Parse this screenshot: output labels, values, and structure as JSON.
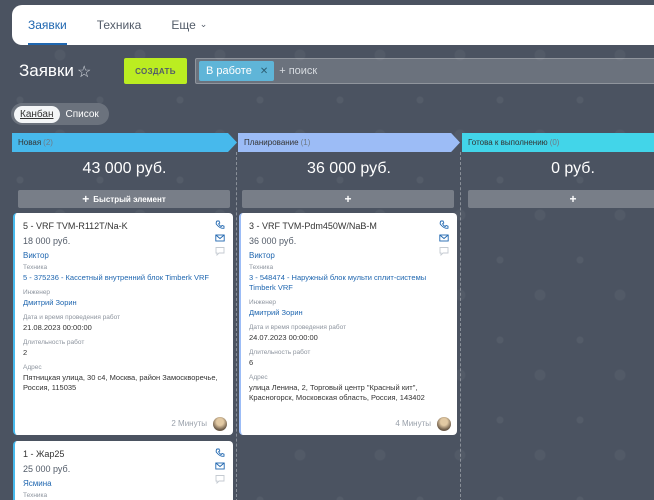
{
  "nav": {
    "tabs": [
      {
        "label": "Заявки",
        "active": true
      },
      {
        "label": "Техника",
        "active": false
      },
      {
        "label": "Еще",
        "active": false
      }
    ]
  },
  "page": {
    "title": "Заявки",
    "create_label": "СОЗДАТЬ",
    "filter_chip": "В работе",
    "search_placeholder": "+ поиск"
  },
  "view": {
    "options": [
      "Канбан",
      "Список"
    ],
    "active": "Канбан"
  },
  "colors": {
    "new": "#47b9ec",
    "plan": "#9cbcf6",
    "ready": "#42d5e9",
    "create": "#bbed21",
    "link": "#2067b0"
  },
  "columns": [
    {
      "title": "Новая",
      "count": "(2)",
      "sum": "43 000 руб.",
      "add_label": "Быстрый элемент",
      "cards": [
        {
          "name": "5 - VRF TVM-R112T/Na-K",
          "price": "18 000 руб.",
          "person": "Виктор",
          "tech_label": "Техника",
          "tech": "5 - 375236 - Кассетный внутренний блок Timberk VRF",
          "eng_label": "Инженер",
          "engineer": "Дмитрий Зорин",
          "date_label": "Дата и время проведения работ",
          "date": "21.08.2023 00:00:00",
          "dur_label": "Длительность работ",
          "duration": "2",
          "addr_label": "Адрес",
          "address": "Пятницкая улица, 30 с4, Москва, район Замоскворечье, Россия, 115035",
          "time": "2 Минуты"
        },
        {
          "name": "1 - Жар25",
          "price": "25 000 руб.",
          "person": "Ясмина",
          "tech_label": "Техника"
        }
      ]
    },
    {
      "title": "Планирование",
      "count": "(1)",
      "sum": "36 000 руб.",
      "add_label": "",
      "cards": [
        {
          "name": "3 - VRF TVM-Pdm450W/NaB-M",
          "price": "36 000 руб.",
          "person": "Виктор",
          "tech_label": "Техника",
          "tech": "3 - 548474 - Наружный блок мульти сплит-системы Timberk VRF",
          "eng_label": "Инженер",
          "engineer": "Дмитрий Зорин",
          "date_label": "Дата и время проведения работ",
          "date": "24.07.2023 00:00:00",
          "dur_label": "Длительность работ",
          "duration": "6",
          "addr_label": "Адрес",
          "address": "улица Ленина, 2, Торговый центр \"Красный кит\", Красногорск, Московская область, Россия, 143402",
          "time": "4 Минуты"
        }
      ]
    },
    {
      "title": "Готова к выполнению",
      "count": "(0)",
      "sum": "0 руб.",
      "add_label": ""
    }
  ]
}
